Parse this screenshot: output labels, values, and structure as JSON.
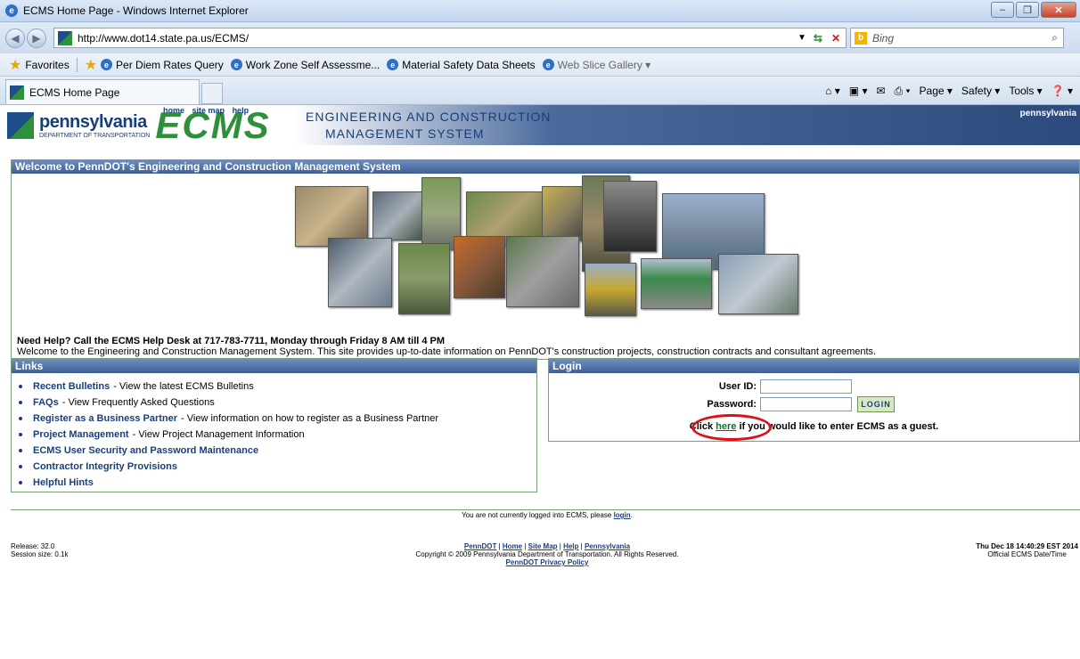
{
  "window": {
    "title": "ECMS Home Page - Windows Internet Explorer"
  },
  "address": {
    "url": "http://www.dot14.state.pa.us/ECMS/",
    "search_placeholder": "Bing"
  },
  "favorites": {
    "label": "Favorites",
    "items": [
      "Per Diem Rates Query",
      "Work Zone Self Assessme...",
      "Material Safety Data Sheets",
      "Web Slice Gallery"
    ]
  },
  "tab": {
    "label": "ECMS Home Page"
  },
  "commandbar": {
    "page": "Page",
    "safety": "Safety",
    "tools": "Tools"
  },
  "banner": {
    "pa_word": "pennsylvania",
    "pa_sub": "DEPARTMENT OF TRANSPORTATION",
    "ecms": "ECMS",
    "toplinks": [
      "home",
      "site map",
      "help"
    ],
    "title_line1": "ENGINEERING AND CONSTRUCTION",
    "title_line2": "MANAGEMENT SYSTEM",
    "right": "pennsylvania"
  },
  "welcome": {
    "header": "Welcome to PennDOT's Engineering and Construction Management System",
    "help": "Need Help? Call the ECMS Help Desk at 717-783-7711, Monday through Friday 8 AM till 4 PM",
    "intro": "Welcome to the Engineering and Construction Management System. This site provides up-to-date information on PennDOT's construction projects, construction contracts and consultant agreements."
  },
  "links": {
    "header": "Links",
    "items": [
      {
        "label": "Recent Bulletins",
        "desc": "- View the latest ECMS Bulletins"
      },
      {
        "label": "FAQs",
        "desc": "- View Frequently Asked Questions"
      },
      {
        "label": "Register as a Business Partner",
        "desc": "- View information on how to register as a Business Partner"
      },
      {
        "label": "Project Management",
        "desc": "- View Project Management Information"
      },
      {
        "label": "ECMS User Security and Password Maintenance",
        "desc": ""
      },
      {
        "label": "Contractor Integrity Provisions",
        "desc": ""
      },
      {
        "label": "Helpful Hints",
        "desc": ""
      }
    ]
  },
  "login": {
    "header": "Login",
    "user_label": "User ID:",
    "pass_label": "Password:",
    "button": "LOGIN",
    "guest_pre": "Click",
    "guest_link": "here",
    "guest_post": "if you would like to enter ECMS as a guest."
  },
  "footer": {
    "not_logged": "You are not currently logged into ECMS, please",
    "login_link": "login",
    "release": "Release: 32.0",
    "session": "Session size: 0.1k",
    "links": [
      "PennDOT",
      "Home",
      "Site Map",
      "Help",
      "Pennsylvania"
    ],
    "copyright": "Copyright © 2009 Pennsylvania Department of Transportation. All Rights Reserved.",
    "privacy": "PennDOT Privacy Policy",
    "datetime": "Thu Dec 18 14:40:29 EST 2014",
    "datetime_label": "Official ECMS Date/Time"
  }
}
